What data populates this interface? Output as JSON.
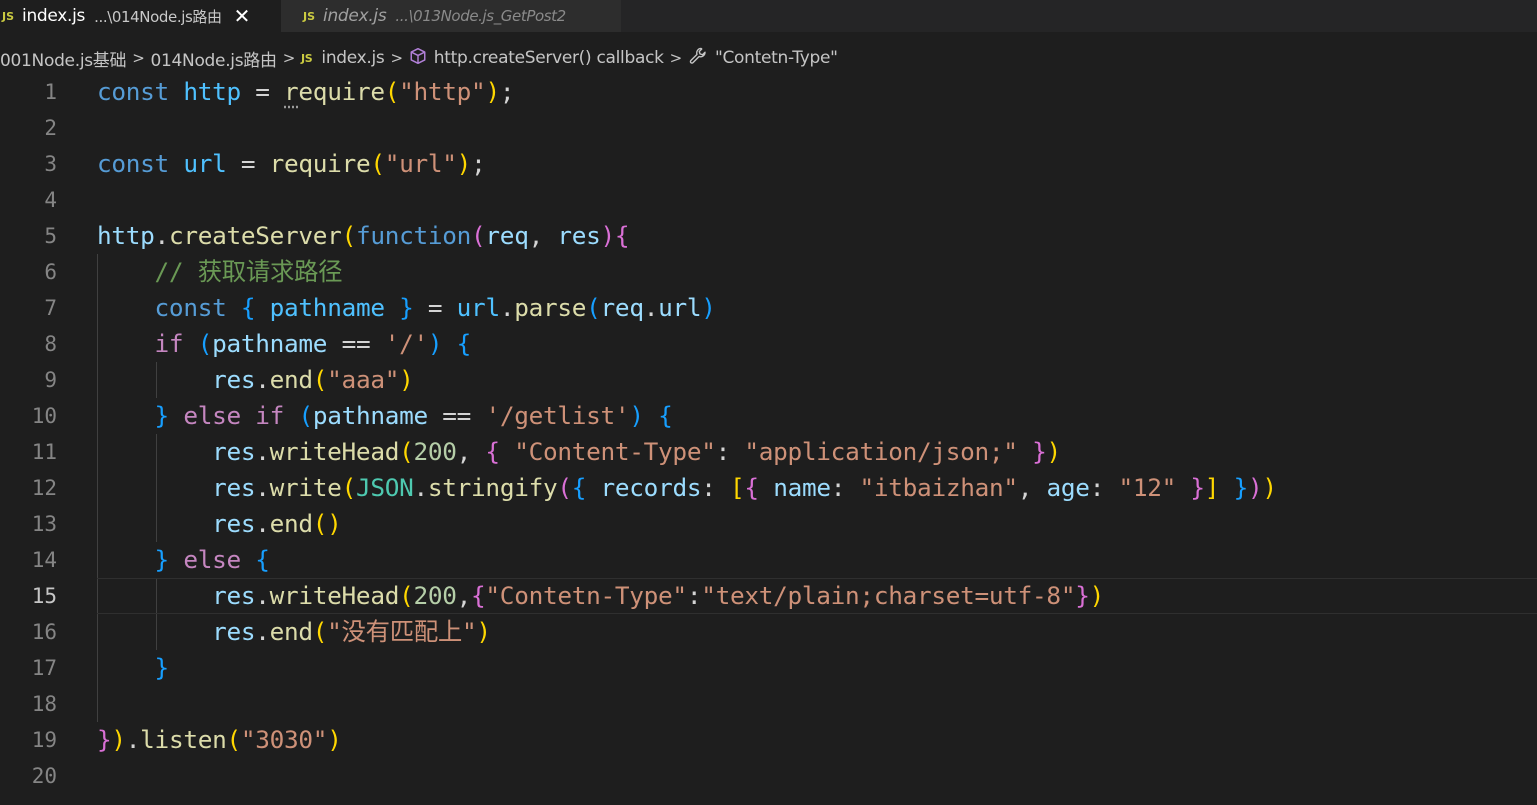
{
  "tabs": [
    {
      "badge": "JS",
      "name": "index.js",
      "path": "...\\014Node.js路由",
      "close": "✕",
      "active": true
    },
    {
      "badge": "JS",
      "name": "index.js",
      "path": "...\\013Node.js_GetPost2",
      "active": false
    }
  ],
  "breadcrumb": {
    "items": [
      "001Node.js基础",
      "014Node.js路由",
      "index.js",
      "http.createServer() callback",
      "\"Contetn-Type\""
    ],
    "separator": ">",
    "file_badge": "JS"
  },
  "editor": {
    "current_line": 15,
    "lines": [
      {
        "n": "1",
        "tokens": [
          [
            "t-kw",
            "const"
          ],
          [
            "t-p",
            " "
          ],
          [
            "t-var",
            "http"
          ],
          [
            "t-p",
            " = "
          ],
          [
            "t-fn dots",
            "r"
          ],
          [
            "t-fn",
            "equire"
          ],
          [
            "b1",
            "("
          ],
          [
            "t-str",
            "\"http\""
          ],
          [
            "b1",
            ")"
          ],
          [
            "t-p",
            ";"
          ]
        ]
      },
      {
        "n": "2",
        "tokens": []
      },
      {
        "n": "3",
        "tokens": [
          [
            "t-kw",
            "const"
          ],
          [
            "t-p",
            " "
          ],
          [
            "t-var",
            "url"
          ],
          [
            "t-p",
            " = "
          ],
          [
            "t-fn",
            "require"
          ],
          [
            "b1",
            "("
          ],
          [
            "t-str",
            "\"url\""
          ],
          [
            "b1",
            ")"
          ],
          [
            "t-p",
            ";"
          ]
        ]
      },
      {
        "n": "4",
        "tokens": []
      },
      {
        "n": "5",
        "tokens": [
          [
            "t-prop",
            "http"
          ],
          [
            "t-p",
            "."
          ],
          [
            "t-fn",
            "createServer"
          ],
          [
            "b1",
            "("
          ],
          [
            "t-kw",
            "function"
          ],
          [
            "b2",
            "("
          ],
          [
            "t-prop",
            "req"
          ],
          [
            "t-p",
            ", "
          ],
          [
            "t-prop",
            "res"
          ],
          [
            "b2",
            ")"
          ],
          [
            "b2",
            "{"
          ]
        ]
      },
      {
        "n": "6",
        "tokens": [
          [
            "t-p",
            "    "
          ],
          [
            "t-com",
            "// 获取请求路径"
          ]
        ]
      },
      {
        "n": "7",
        "tokens": [
          [
            "t-p",
            "    "
          ],
          [
            "t-kw",
            "const"
          ],
          [
            "t-p",
            " "
          ],
          [
            "b3",
            "{"
          ],
          [
            "t-p",
            " "
          ],
          [
            "t-var",
            "pathname"
          ],
          [
            "t-p",
            " "
          ],
          [
            "b3",
            "}"
          ],
          [
            "t-p",
            " = "
          ],
          [
            "t-var",
            "url"
          ],
          [
            "t-p",
            "."
          ],
          [
            "t-fn",
            "parse"
          ],
          [
            "b3",
            "("
          ],
          [
            "t-prop",
            "req"
          ],
          [
            "t-p",
            "."
          ],
          [
            "t-prop",
            "url"
          ],
          [
            "b3",
            ")"
          ]
        ]
      },
      {
        "n": "8",
        "tokens": [
          [
            "t-p",
            "    "
          ],
          [
            "t-ctrl",
            "if"
          ],
          [
            "t-p",
            " "
          ],
          [
            "b3",
            "("
          ],
          [
            "t-prop",
            "pathname"
          ],
          [
            "t-p",
            " == "
          ],
          [
            "t-str",
            "'/'"
          ],
          [
            "b3",
            ")"
          ],
          [
            "t-p",
            " "
          ],
          [
            "b3",
            "{"
          ]
        ]
      },
      {
        "n": "9",
        "tokens": [
          [
            "t-p",
            "        "
          ],
          [
            "t-prop",
            "res"
          ],
          [
            "t-p",
            "."
          ],
          [
            "t-fn",
            "end"
          ],
          [
            "b1",
            "("
          ],
          [
            "t-str",
            "\"aaa\""
          ],
          [
            "b1",
            ")"
          ]
        ]
      },
      {
        "n": "10",
        "tokens": [
          [
            "t-p",
            "    "
          ],
          [
            "b3",
            "}"
          ],
          [
            "t-p",
            " "
          ],
          [
            "t-ctrl",
            "else"
          ],
          [
            "t-p",
            " "
          ],
          [
            "t-ctrl",
            "if"
          ],
          [
            "t-p",
            " "
          ],
          [
            "b3",
            "("
          ],
          [
            "t-prop",
            "pathname"
          ],
          [
            "t-p",
            " == "
          ],
          [
            "t-str",
            "'/getlist'"
          ],
          [
            "b3",
            ")"
          ],
          [
            "t-p",
            " "
          ],
          [
            "b3",
            "{"
          ]
        ]
      },
      {
        "n": "11",
        "tokens": [
          [
            "t-p",
            "        "
          ],
          [
            "t-prop",
            "res"
          ],
          [
            "t-p",
            "."
          ],
          [
            "t-fn",
            "writeHead"
          ],
          [
            "b1",
            "("
          ],
          [
            "t-num",
            "200"
          ],
          [
            "t-p",
            ", "
          ],
          [
            "b2",
            "{"
          ],
          [
            "t-p",
            " "
          ],
          [
            "t-str",
            "\"Content-Type\""
          ],
          [
            "t-p",
            ": "
          ],
          [
            "t-str",
            "\"application/json;\""
          ],
          [
            "t-p",
            " "
          ],
          [
            "b2",
            "}"
          ],
          [
            "b1",
            ")"
          ]
        ]
      },
      {
        "n": "12",
        "tokens": [
          [
            "t-p",
            "        "
          ],
          [
            "t-prop",
            "res"
          ],
          [
            "t-p",
            "."
          ],
          [
            "t-fn",
            "write"
          ],
          [
            "b1",
            "("
          ],
          [
            "t-cls",
            "JSON"
          ],
          [
            "t-p",
            "."
          ],
          [
            "t-fn",
            "stringify"
          ],
          [
            "b2",
            "("
          ],
          [
            "b3",
            "{"
          ],
          [
            "t-p",
            " "
          ],
          [
            "t-prop",
            "records"
          ],
          [
            "t-p",
            ": "
          ],
          [
            "b1",
            "["
          ],
          [
            "b2",
            "{"
          ],
          [
            "t-p",
            " "
          ],
          [
            "t-prop",
            "name"
          ],
          [
            "t-p",
            ": "
          ],
          [
            "t-str",
            "\"itbaizhan\""
          ],
          [
            "t-p",
            ", "
          ],
          [
            "t-prop",
            "age"
          ],
          [
            "t-p",
            ": "
          ],
          [
            "t-str",
            "\"12\""
          ],
          [
            "t-p",
            " "
          ],
          [
            "b2",
            "}"
          ],
          [
            "b1",
            "]"
          ],
          [
            "t-p",
            " "
          ],
          [
            "b3",
            "}"
          ],
          [
            "b2",
            ")"
          ],
          [
            "b1",
            ")"
          ]
        ]
      },
      {
        "n": "13",
        "tokens": [
          [
            "t-p",
            "        "
          ],
          [
            "t-prop",
            "res"
          ],
          [
            "t-p",
            "."
          ],
          [
            "t-fn",
            "end"
          ],
          [
            "b1",
            "()"
          ]
        ]
      },
      {
        "n": "14",
        "tokens": [
          [
            "t-p",
            "    "
          ],
          [
            "b3",
            "}"
          ],
          [
            "t-p",
            " "
          ],
          [
            "t-ctrl",
            "else"
          ],
          [
            "t-p",
            " "
          ],
          [
            "b3",
            "{"
          ]
        ]
      },
      {
        "n": "15",
        "tokens": [
          [
            "t-p",
            "        "
          ],
          [
            "t-prop",
            "res"
          ],
          [
            "t-p",
            "."
          ],
          [
            "t-fn",
            "writeHead"
          ],
          [
            "b1",
            "("
          ],
          [
            "t-num",
            "200"
          ],
          [
            "t-p",
            ","
          ],
          [
            "b2",
            "{"
          ],
          [
            "t-str",
            "\"Contetn-Type\""
          ],
          [
            "t-p",
            ":"
          ],
          [
            "t-str",
            "\"text/plain;charset=utf-8\""
          ],
          [
            "b2",
            "}"
          ],
          [
            "b1",
            ")"
          ]
        ]
      },
      {
        "n": "16",
        "tokens": [
          [
            "t-p",
            "        "
          ],
          [
            "t-prop",
            "res"
          ],
          [
            "t-p",
            "."
          ],
          [
            "t-fn",
            "end"
          ],
          [
            "b1",
            "("
          ],
          [
            "t-str",
            "\"没有匹配上\""
          ],
          [
            "b1",
            ")"
          ]
        ]
      },
      {
        "n": "17",
        "tokens": [
          [
            "t-p",
            "    "
          ],
          [
            "b3",
            "}"
          ]
        ]
      },
      {
        "n": "18",
        "tokens": []
      },
      {
        "n": "19",
        "tokens": [
          [
            "b2",
            "}"
          ],
          [
            "b1",
            ")"
          ],
          [
            "t-p",
            "."
          ],
          [
            "t-fn",
            "listen"
          ],
          [
            "b1",
            "("
          ],
          [
            "t-str",
            "\"3030\""
          ],
          [
            "b1",
            ")"
          ]
        ]
      },
      {
        "n": "20",
        "tokens": []
      }
    ]
  }
}
